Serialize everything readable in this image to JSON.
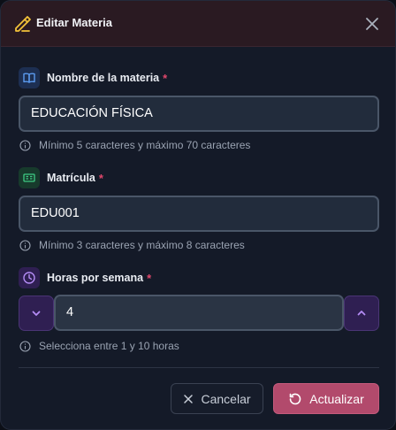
{
  "header": {
    "title": "Editar Materia"
  },
  "fields": {
    "name": {
      "label": "Nombre de la materia",
      "required_mark": "*",
      "value": "EDUCACIÓN FÍSICA",
      "hint": "Mínimo 5 caracteres y máximo 70 caracteres"
    },
    "code": {
      "label": "Matrícula",
      "required_mark": "*",
      "value": "EDU001",
      "hint": "Mínimo 3 caracteres y máximo 8 caracteres"
    },
    "hours": {
      "label": "Horas por semana",
      "required_mark": "*",
      "value": "4",
      "hint": "Selecciona entre 1 y 10 horas"
    }
  },
  "actions": {
    "cancel_label": "Cancelar",
    "update_label": "Actualizar"
  },
  "colors": {
    "accent": "#b24a6c",
    "required": "#e0476b",
    "stepper": "#2f1f52"
  },
  "icons": {
    "title": "pencil-icon",
    "close": "close-icon",
    "name": "book-open-icon",
    "code": "id-card-icon",
    "hours": "clock-icon",
    "hint": "info-icon",
    "decrement": "chevron-down-icon",
    "increment": "chevron-up-icon",
    "cancel": "x-icon",
    "update": "refresh-icon"
  }
}
